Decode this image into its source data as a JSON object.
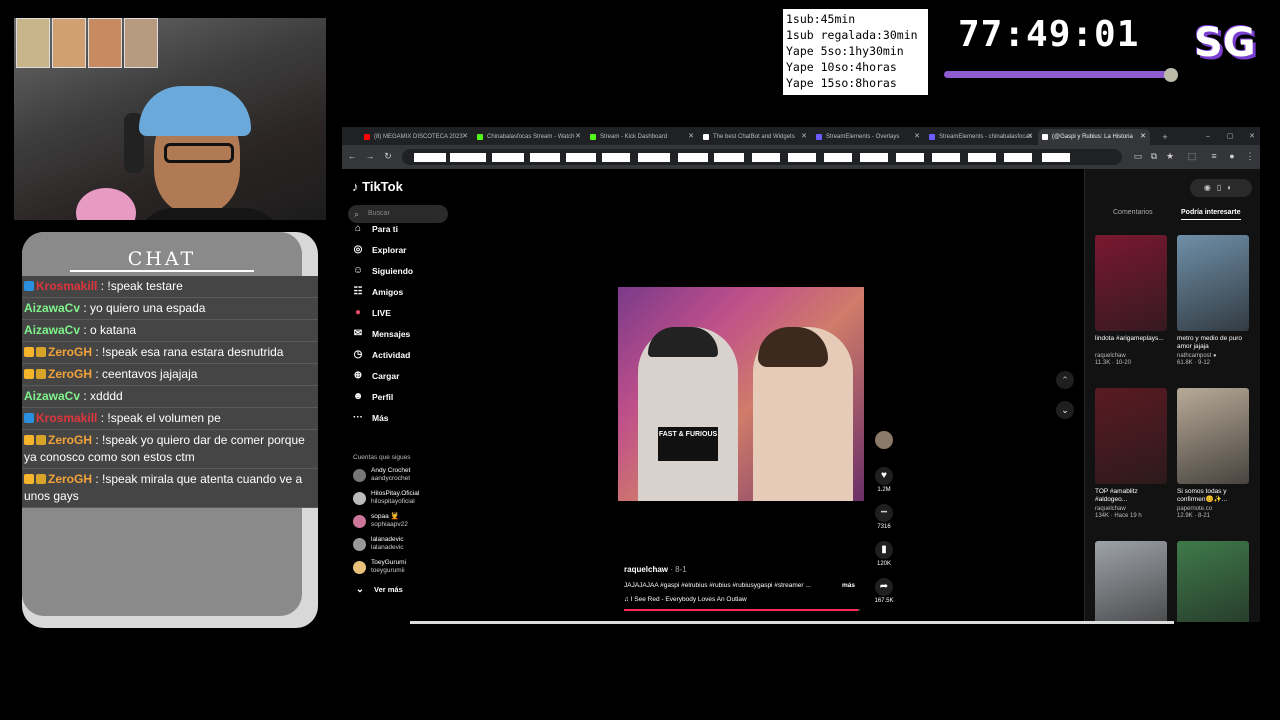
{
  "chat": {
    "title": "CHAT",
    "messages": [
      {
        "badge": "x",
        "user": "Krosmakill",
        "user_color": "#e0353d",
        "text": " : !speak testare"
      },
      {
        "badge": "",
        "user": "AizawaCv",
        "user_color": "#7ff28a",
        "text": " : yo quiero una espada"
      },
      {
        "badge": "",
        "user": "AizawaCv",
        "user_color": "#7ff28a",
        "text": " : o katana"
      },
      {
        "badge": "sub",
        "user": "ZeroGH",
        "user_color": "#f2a33a",
        "text": " : !speak esa rana estara desnutrida"
      },
      {
        "badge": "sub",
        "user": "ZeroGH",
        "user_color": "#f2a33a",
        "text": " : ceentavos jajajaja"
      },
      {
        "badge": "",
        "user": "AizawaCv",
        "user_color": "#7ff28a",
        "text": " : xdddd"
      },
      {
        "badge": "x",
        "user": "Krosmakill",
        "user_color": "#e0353d",
        "text": " : !speak el volumen pe"
      },
      {
        "badge": "sub",
        "user": "ZeroGH",
        "user_color": "#f2a33a",
        "text": " : !speak yo quiero dar de comer porque ya conosco como son estos ctm"
      },
      {
        "badge": "sub",
        "user": "ZeroGH",
        "user_color": "#f2a33a",
        "text": " : !speak mirala que atenta cuando ve a unos gays"
      }
    ]
  },
  "subathon": {
    "rules": [
      "1sub:45min",
      "1sub regalada:30min",
      "Yape 5so:1hy30min",
      "Yape 10so:4horas",
      "Yape 15so:8horas"
    ],
    "timer": "77:49:01",
    "logo": "SG"
  },
  "browser": {
    "tabs": [
      {
        "label": "(8) MEGAMIX DISCOTECA 2023",
        "color": "#ff0000"
      },
      {
        "label": "Chinabalasfocas Stream - Watch",
        "color": "#53fc18"
      },
      {
        "label": "Stream - Kick Dashboard",
        "color": "#53fc18"
      },
      {
        "label": "The best ChatBot and Widgets",
        "color": "#ffffff"
      },
      {
        "label": "StreamElements - Overlays",
        "color": "#6a5cff"
      },
      {
        "label": "StreamElements - chinabalasfocas",
        "color": "#6a5cff"
      },
      {
        "label": "(@Gaspi y Rubius: La Historia",
        "color": "#ffffff"
      }
    ],
    "new_tab": "+"
  },
  "tiktok": {
    "logo": "TikTok",
    "search_placeholder": "Buscar",
    "nav": [
      {
        "label": "Para ti",
        "icon": "home-icon",
        "glyph": "⌂"
      },
      {
        "label": "Explorar",
        "icon": "compass-icon",
        "glyph": "◎"
      },
      {
        "label": "Siguiendo",
        "icon": "following-icon",
        "glyph": "☺"
      },
      {
        "label": "Amigos",
        "icon": "friends-icon",
        "glyph": "☷"
      },
      {
        "label": "LIVE",
        "icon": "live-icon",
        "glyph": "●"
      },
      {
        "label": "Mensajes",
        "icon": "messages-icon",
        "glyph": "✉"
      },
      {
        "label": "Actividad",
        "icon": "activity-icon",
        "glyph": "◷"
      },
      {
        "label": "Cargar",
        "icon": "upload-icon",
        "glyph": "⊕"
      },
      {
        "label": "Perfil",
        "icon": "profile-icon",
        "glyph": "☻"
      },
      {
        "label": "Más",
        "icon": "more-icon",
        "glyph": "···"
      }
    ],
    "following_title": "Cuentas que sigues",
    "following": [
      {
        "name": "Andy Crochet",
        "handle": "aandycrochet",
        "color": "#777"
      },
      {
        "name": "HilosPitay.Oficial",
        "handle": "hilospitayoficial",
        "color": "#bbb"
      },
      {
        "name": "sopaa 💆",
        "handle": "sophiaapv22",
        "color": "#c79"
      },
      {
        "name": "lalanadevic",
        "handle": "lalanadevic",
        "color": "#999"
      },
      {
        "name": "ToeyGurumi",
        "handle": "toeygurumii",
        "color": "#e8c07a"
      }
    ],
    "see_more": "Ver más",
    "video": {
      "author": "raquelchaw",
      "date": " · 8-1",
      "caption": "JAJAJAJAA #gaspi #elrubius #rubius #rubiusygaspi #streamer ...",
      "more": "más",
      "music": "♫  I See Red - Everybody Loves An Outlaw",
      "shirt_text": "FAST & FURIOUS",
      "progress": 0.99
    },
    "actions": [
      {
        "icon": "heart-icon",
        "glyph": "♥",
        "count": "1.2M"
      },
      {
        "icon": "comment-icon",
        "glyph": "•••",
        "count": "7316"
      },
      {
        "icon": "bookmark-icon",
        "glyph": "▮",
        "count": "120K"
      },
      {
        "icon": "share-icon",
        "glyph": "➦",
        "count": "167.5K"
      }
    ],
    "right_tabs": [
      "Comentarios",
      "Podría interesarte"
    ],
    "cards": [
      {
        "title": "lindota #arigameplays...",
        "user": "raquelchaw",
        "stats": "11.3K · 10-20",
        "color": "#7a1830"
      },
      {
        "title": "metro y medio de puro amor jajaja",
        "user": "nathcampost ●",
        "stats": "61.8K · 9-12",
        "color": "#6f8fa8"
      },
      {
        "title": "TOP #amablitz #aldogeo...",
        "user": "raquelchaw",
        "stats": "134K · Hace 19 h",
        "color": "#5a1a22"
      },
      {
        "title": "Si somos todas y confirmen😊✨...",
        "user": "papernote.co",
        "stats": "12.9K · 8-21",
        "color": "#b8aa98"
      },
      {
        "title": "",
        "user": "",
        "stats": "",
        "color": "#9ea3a8"
      },
      {
        "title": "",
        "user": "",
        "stats": "",
        "color": "#3f7a4a"
      }
    ]
  }
}
